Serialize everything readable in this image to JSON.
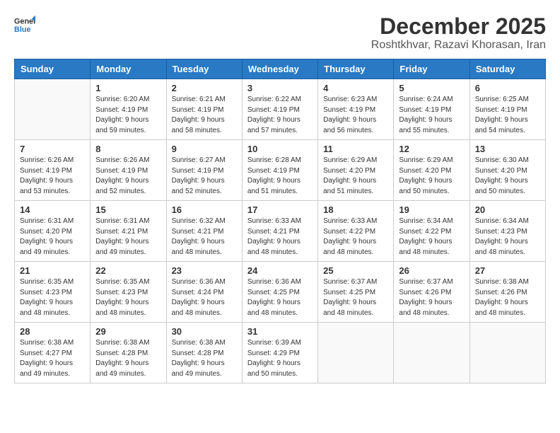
{
  "logo": {
    "text_general": "General",
    "text_blue": "Blue"
  },
  "title": "December 2025",
  "subtitle": "Roshtkhvar, Razavi Khorasan, Iran",
  "days_of_week": [
    "Sunday",
    "Monday",
    "Tuesday",
    "Wednesday",
    "Thursday",
    "Friday",
    "Saturday"
  ],
  "weeks": [
    [
      {
        "day": "",
        "sunrise": "",
        "sunset": "",
        "daylight": ""
      },
      {
        "day": "1",
        "sunrise": "6:20 AM",
        "sunset": "4:19 PM",
        "daylight": "9 hours and 59 minutes."
      },
      {
        "day": "2",
        "sunrise": "6:21 AM",
        "sunset": "4:19 PM",
        "daylight": "9 hours and 58 minutes."
      },
      {
        "day": "3",
        "sunrise": "6:22 AM",
        "sunset": "4:19 PM",
        "daylight": "9 hours and 57 minutes."
      },
      {
        "day": "4",
        "sunrise": "6:23 AM",
        "sunset": "4:19 PM",
        "daylight": "9 hours and 56 minutes."
      },
      {
        "day": "5",
        "sunrise": "6:24 AM",
        "sunset": "4:19 PM",
        "daylight": "9 hours and 55 minutes."
      },
      {
        "day": "6",
        "sunrise": "6:25 AM",
        "sunset": "4:19 PM",
        "daylight": "9 hours and 54 minutes."
      }
    ],
    [
      {
        "day": "7",
        "sunrise": "6:26 AM",
        "sunset": "4:19 PM",
        "daylight": "9 hours and 53 minutes."
      },
      {
        "day": "8",
        "sunrise": "6:26 AM",
        "sunset": "4:19 PM",
        "daylight": "9 hours and 52 minutes."
      },
      {
        "day": "9",
        "sunrise": "6:27 AM",
        "sunset": "4:19 PM",
        "daylight": "9 hours and 52 minutes."
      },
      {
        "day": "10",
        "sunrise": "6:28 AM",
        "sunset": "4:19 PM",
        "daylight": "9 hours and 51 minutes."
      },
      {
        "day": "11",
        "sunrise": "6:29 AM",
        "sunset": "4:20 PM",
        "daylight": "9 hours and 51 minutes."
      },
      {
        "day": "12",
        "sunrise": "6:29 AM",
        "sunset": "4:20 PM",
        "daylight": "9 hours and 50 minutes."
      },
      {
        "day": "13",
        "sunrise": "6:30 AM",
        "sunset": "4:20 PM",
        "daylight": "9 hours and 50 minutes."
      }
    ],
    [
      {
        "day": "14",
        "sunrise": "6:31 AM",
        "sunset": "4:20 PM",
        "daylight": "9 hours and 49 minutes."
      },
      {
        "day": "15",
        "sunrise": "6:31 AM",
        "sunset": "4:21 PM",
        "daylight": "9 hours and 49 minutes."
      },
      {
        "day": "16",
        "sunrise": "6:32 AM",
        "sunset": "4:21 PM",
        "daylight": "9 hours and 48 minutes."
      },
      {
        "day": "17",
        "sunrise": "6:33 AM",
        "sunset": "4:21 PM",
        "daylight": "9 hours and 48 minutes."
      },
      {
        "day": "18",
        "sunrise": "6:33 AM",
        "sunset": "4:22 PM",
        "daylight": "9 hours and 48 minutes."
      },
      {
        "day": "19",
        "sunrise": "6:34 AM",
        "sunset": "4:22 PM",
        "daylight": "9 hours and 48 minutes."
      },
      {
        "day": "20",
        "sunrise": "6:34 AM",
        "sunset": "4:23 PM",
        "daylight": "9 hours and 48 minutes."
      }
    ],
    [
      {
        "day": "21",
        "sunrise": "6:35 AM",
        "sunset": "4:23 PM",
        "daylight": "9 hours and 48 minutes."
      },
      {
        "day": "22",
        "sunrise": "6:35 AM",
        "sunset": "4:23 PM",
        "daylight": "9 hours and 48 minutes."
      },
      {
        "day": "23",
        "sunrise": "6:36 AM",
        "sunset": "4:24 PM",
        "daylight": "9 hours and 48 minutes."
      },
      {
        "day": "24",
        "sunrise": "6:36 AM",
        "sunset": "4:25 PM",
        "daylight": "9 hours and 48 minutes."
      },
      {
        "day": "25",
        "sunrise": "6:37 AM",
        "sunset": "4:25 PM",
        "daylight": "9 hours and 48 minutes."
      },
      {
        "day": "26",
        "sunrise": "6:37 AM",
        "sunset": "4:26 PM",
        "daylight": "9 hours and 48 minutes."
      },
      {
        "day": "27",
        "sunrise": "6:38 AM",
        "sunset": "4:26 PM",
        "daylight": "9 hours and 48 minutes."
      }
    ],
    [
      {
        "day": "28",
        "sunrise": "6:38 AM",
        "sunset": "4:27 PM",
        "daylight": "9 hours and 49 minutes."
      },
      {
        "day": "29",
        "sunrise": "6:38 AM",
        "sunset": "4:28 PM",
        "daylight": "9 hours and 49 minutes."
      },
      {
        "day": "30",
        "sunrise": "6:38 AM",
        "sunset": "4:28 PM",
        "daylight": "9 hours and 49 minutes."
      },
      {
        "day": "31",
        "sunrise": "6:39 AM",
        "sunset": "4:29 PM",
        "daylight": "9 hours and 50 minutes."
      },
      {
        "day": "",
        "sunrise": "",
        "sunset": "",
        "daylight": ""
      },
      {
        "day": "",
        "sunrise": "",
        "sunset": "",
        "daylight": ""
      },
      {
        "day": "",
        "sunrise": "",
        "sunset": "",
        "daylight": ""
      }
    ]
  ],
  "labels": {
    "sunrise": "Sunrise:",
    "sunset": "Sunset:",
    "daylight": "Daylight:"
  }
}
